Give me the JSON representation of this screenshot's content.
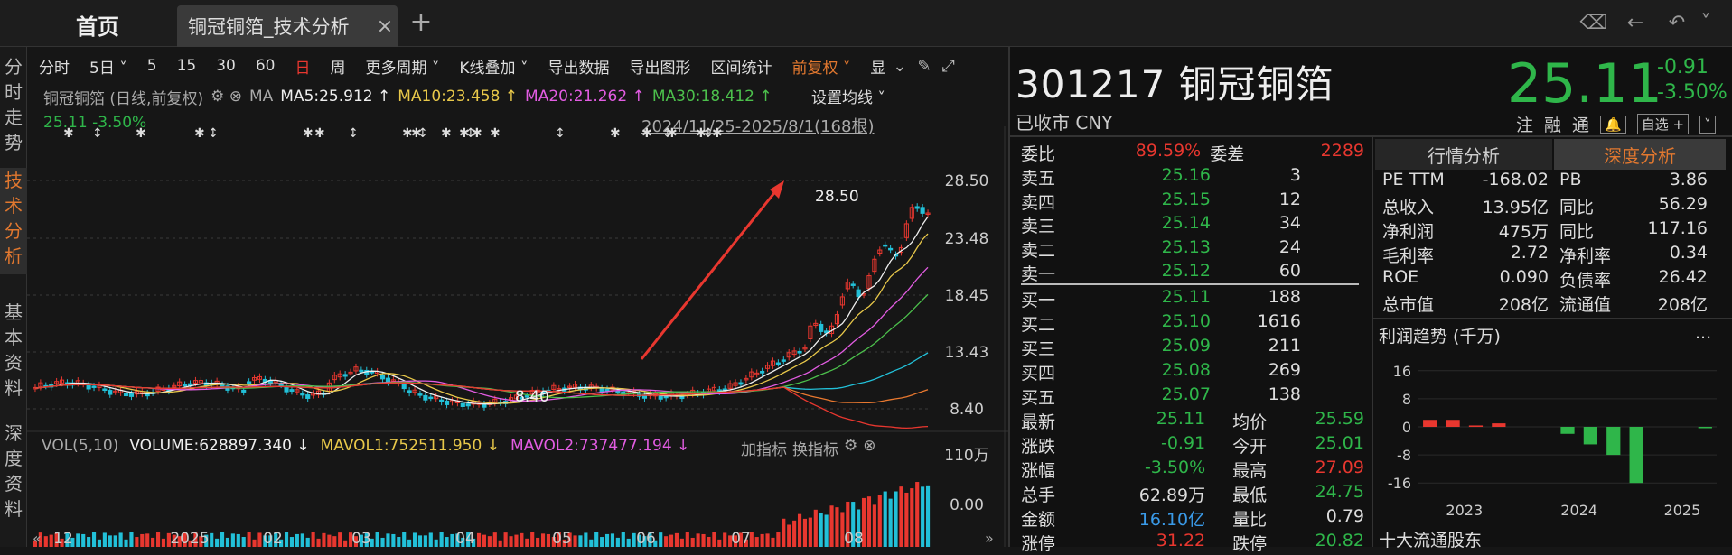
{
  "tabs": {
    "home": "首页",
    "active": "铜冠铜箔_技术分析",
    "close": "×",
    "add": "+"
  },
  "left_nav": [
    "分\n时\n走\n势",
    "技\n术\n分\n析",
    "基\n本\n资\n料",
    "深\n度\n资\n料"
  ],
  "toolbar": [
    "分时",
    "5日 ˅",
    "5",
    "15",
    "30",
    "60",
    "日",
    "周",
    "更多周期 ˅",
    "K线叠加 ˅",
    "导出数据",
    "导出图形",
    "区间统计",
    "前复权 ˅",
    "显"
  ],
  "chart_head": {
    "name": "铜冠铜箔 (日线,前复权)",
    "ma": "MA",
    "ma5": "MA5:25.912 ↑",
    "ma10": "MA10:23.458 ↑",
    "ma20": "MA20:21.262 ↑",
    "ma30": "MA30:18.412 ↑",
    "set_avg": "设置均线 ˅",
    "price_line": "25.11  -3.50%",
    "date_range": "2024/11/25-2025/8/1(168根)"
  },
  "price_axis": [
    "28.50",
    "23.48",
    "18.45",
    "13.43",
    "8.40"
  ],
  "annotations": {
    "high": "28.50",
    "low": "8.40"
  },
  "volume_head": {
    "vol": "VOL(5,10)",
    "volume": "VOLUME:628897.340 ↓",
    "mavol1": "MAVOL1:752511.950 ↓",
    "mavol2": "MAVOL2:737477.194 ↓",
    "add_ind": "加指标",
    "chg_ind": "换指标"
  },
  "volume_axis": [
    "110万",
    "0.00"
  ],
  "x_axis": [
    "12",
    "2025",
    "02",
    "03",
    "04",
    "05",
    "06",
    "07",
    "08"
  ],
  "stock": {
    "code_name": "301217 铜冠铜箔",
    "status": "已收市 CNY",
    "price": "25.11",
    "change": "-0.91",
    "change_pct": "-3.50%"
  },
  "quick_icons": [
    "注",
    "融",
    "通",
    "自选 +",
    "˅"
  ],
  "order_book": {
    "wei_bi_label": "委比",
    "wei_bi": "89.59%",
    "wei_cha_label": "委差",
    "wei_cha": "2289",
    "asks": [
      {
        "l": "卖五",
        "p": "25.16",
        "v": "3"
      },
      {
        "l": "卖四",
        "p": "25.15",
        "v": "12"
      },
      {
        "l": "卖三",
        "p": "25.14",
        "v": "34"
      },
      {
        "l": "卖二",
        "p": "25.13",
        "v": "24"
      },
      {
        "l": "卖一",
        "p": "25.12",
        "v": "60"
      }
    ],
    "bids": [
      {
        "l": "买一",
        "p": "25.11",
        "v": "188"
      },
      {
        "l": "买二",
        "p": "25.10",
        "v": "1616"
      },
      {
        "l": "买三",
        "p": "25.09",
        "v": "211"
      },
      {
        "l": "买四",
        "p": "25.08",
        "v": "269"
      },
      {
        "l": "买五",
        "p": "25.07",
        "v": "138"
      }
    ],
    "stats": [
      {
        "l": "最新",
        "p": "25.11",
        "pc": "#2fb64a",
        "l2": "均价",
        "r2": "25.59",
        "rc": "#2fb64a"
      },
      {
        "l": "涨跌",
        "p": "-0.91",
        "pc": "#2fb64a",
        "l2": "今开",
        "r2": "25.01",
        "rc": "#2fb64a"
      },
      {
        "l": "涨幅",
        "p": "-3.50%",
        "pc": "#2fb64a",
        "l2": "最高",
        "r2": "27.09",
        "rc": "#e8372f"
      },
      {
        "l": "总手",
        "p": "62.89万",
        "pc": "#ddd",
        "l2": "最低",
        "r2": "24.75",
        "rc": "#2fb64a"
      },
      {
        "l": "金额",
        "p": "16.10亿",
        "pc": "#3a9ae8",
        "l2": "量比",
        "r2": "0.79",
        "rc": "#ddd"
      },
      {
        "l": "涨停",
        "p": "31.22",
        "pc": "#e8372f",
        "l2": "跌停",
        "r2": "20.82",
        "rc": "#2fb64a"
      }
    ]
  },
  "right_tabs": {
    "tab1": "行情分析",
    "tab2": "深度分析"
  },
  "fundamentals": [
    {
      "k1": "PE TTM",
      "v1": "-168.02",
      "k2": "PB",
      "v2": "3.86"
    },
    {
      "k1": "总收入",
      "v1": "13.95亿",
      "k2": "同比",
      "v2": "56.29"
    },
    {
      "k1": "净利润",
      "v1": "475万",
      "k2": "同比",
      "v2": "117.16"
    },
    {
      "k1": "毛利率",
      "v1": "2.72",
      "k2": "净利率",
      "v2": "0.34"
    },
    {
      "k1": "ROE",
      "v1": "0.090",
      "k2": "负债率",
      "v2": "26.42"
    },
    {
      "k1": "总市值",
      "v1": "208亿",
      "k2": "流通值",
      "v2": "208亿"
    }
  ],
  "profit": {
    "title": "利润趋势 (千万)",
    "more": "...",
    "yticks": [
      "16",
      "8",
      "0",
      "-8",
      "-16"
    ],
    "xticks": [
      "2023",
      "2024",
      "2025"
    ]
  },
  "chart_data": {
    "type": "bar",
    "title": "利润趋势 (千万)",
    "ylim": [
      -18,
      18
    ],
    "series": [
      {
        "values": [
          2,
          2,
          0.4,
          1,
          0,
          0,
          -2,
          -5,
          -8,
          -16,
          0,
          0,
          -0.2
        ]
      }
    ]
  },
  "top10_label": "十大流通股东",
  "colors": {
    "up": "#e8372f",
    "down": "#2fb64a",
    "accent": "#e2782f"
  }
}
